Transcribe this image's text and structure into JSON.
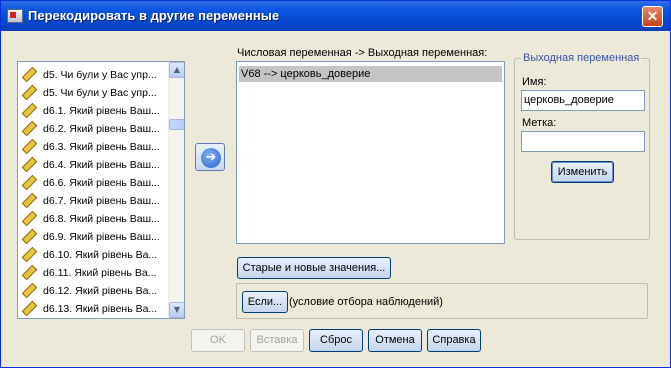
{
  "window": {
    "title": "Перекодировать в другие переменные",
    "close_label": "✕"
  },
  "variables": [
    "d5. Чи були у Вас упр...",
    "d5. Чи були у Вас упр...",
    "d6.1. Який рівень Ваш...",
    "d6.2. Який рівень Ваш...",
    "d6.3. Який рівень Ваш...",
    "d6.4. Який рівень Ваш...",
    "d6.6. Який рівень Ваш...",
    "d6.7. Який рівень Ваш...",
    "d6.8. Який рівень Ваш...",
    "d6.9. Який рівень Ваш...",
    "d6.10. Який рівень Ва...",
    "d6.11. Який рівень Ва...",
    "d6.12. Який рівень Ва...",
    "d6.13. Який рівень Ва..."
  ],
  "variable_icon": "scale-ruler-icon",
  "mapping": {
    "label": "Числовая переменная -> Выходная переменная:",
    "rows": [
      "V68 --> церковь_доверие"
    ]
  },
  "output_variable": {
    "group_title": "Выходная переменная",
    "name_label": "Имя:",
    "name_value": "церковь_доверие",
    "label_label": "Метка:",
    "label_value": "",
    "change_button": "Изменить"
  },
  "old_new_values_button": "Старые и новые значения...",
  "if_button": "Если...",
  "condition_text": "(условие отбора наблюдений)",
  "footer": {
    "ok": "OK",
    "paste": "Вставка",
    "reset": "Сброс",
    "cancel": "Отмена",
    "help": "Справка"
  }
}
